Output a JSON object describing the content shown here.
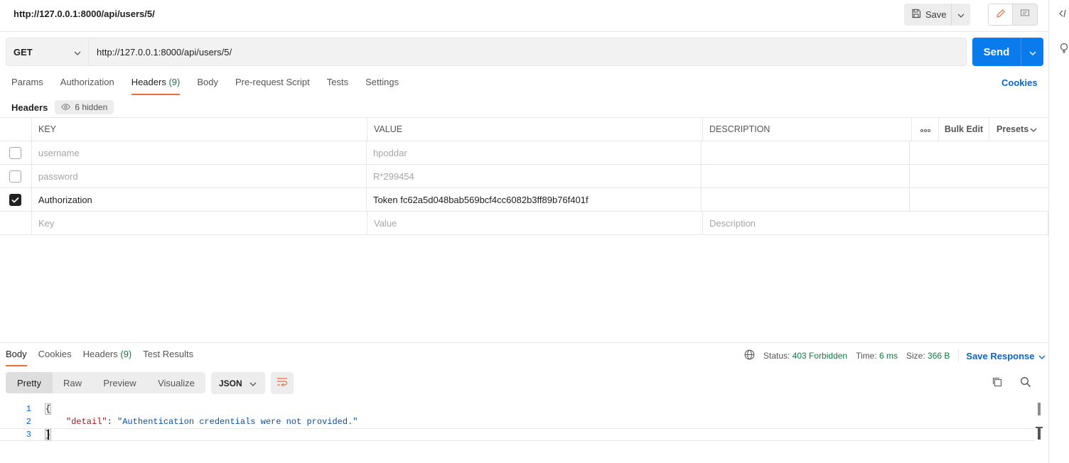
{
  "header": {
    "request_title": "http://127.0.0.1:8000/api/users/5/",
    "save_label": "Save"
  },
  "request": {
    "method": "GET",
    "url": "http://127.0.0.1:8000/api/users/5/",
    "send_label": "Send"
  },
  "tabs": {
    "params": "Params",
    "authorization": "Authorization",
    "headers": "Headers",
    "headers_count": "(9)",
    "body": "Body",
    "prerequest": "Pre-request Script",
    "tests": "Tests",
    "settings": "Settings",
    "cookies": "Cookies"
  },
  "headers_section": {
    "label": "Headers",
    "hidden_label": "6 hidden",
    "columns": {
      "key": "KEY",
      "value": "VALUE",
      "description": "DESCRIPTION",
      "bulk_edit": "Bulk Edit",
      "presets": "Presets"
    },
    "rows": [
      {
        "checked": false,
        "key": "username",
        "value": "hpoddar"
      },
      {
        "checked": false,
        "key": "password",
        "value": "R*299454"
      },
      {
        "checked": true,
        "key": "Authorization",
        "value": "Token fc62a5d048bab569bcf4cc6082b3ff89b76f401f"
      }
    ],
    "placeholders": {
      "key": "Key",
      "value": "Value",
      "description": "Description"
    }
  },
  "response": {
    "tabs": {
      "body": "Body",
      "cookies": "Cookies",
      "headers": "Headers",
      "headers_count": "(9)",
      "test_results": "Test Results"
    },
    "status_label": "Status:",
    "status_value": "403 Forbidden",
    "time_label": "Time:",
    "time_value": "6 ms",
    "size_label": "Size:",
    "size_value": "366 B",
    "save_response": "Save Response",
    "views": {
      "pretty": "Pretty",
      "raw": "Raw",
      "preview": "Preview",
      "visualize": "Visualize"
    },
    "format": "JSON",
    "code": {
      "line_numbers": [
        "1",
        "2",
        "3"
      ],
      "open_brace": "{",
      "close_brace": "}",
      "key": "\"detail\"",
      "colon": ": ",
      "value": "\"Authentication credentials were not provided.\""
    }
  },
  "colors": {
    "send_button": "#097bed",
    "active_tab_underline": "#f26b3a",
    "status_ok_text": "#0f7b3f",
    "link_blue": "#0b64c9"
  }
}
